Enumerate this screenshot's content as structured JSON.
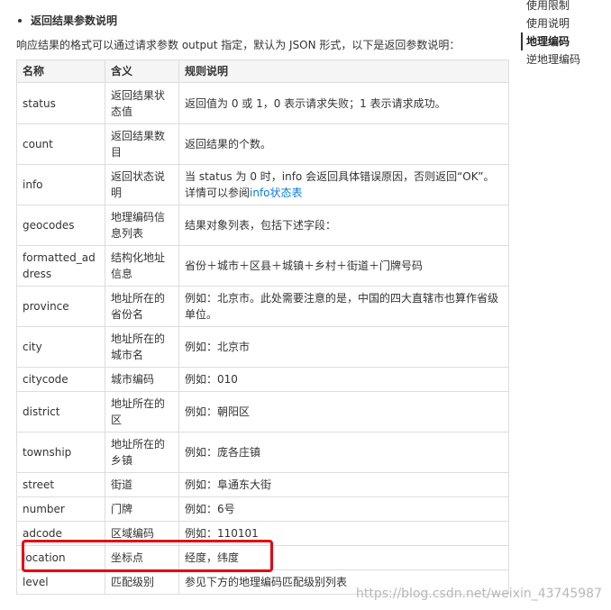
{
  "section": {
    "heading": "返回结果参数说明",
    "description": "响应结果的格式可以通过请求参数 output 指定，默认为 JSON 形式，以下是返回参数说明："
  },
  "table": {
    "headers": [
      "名称",
      "含义",
      "规则说明"
    ],
    "rows": [
      {
        "name": "status",
        "meaning": "返回结果状态值",
        "rule": "返回值为 0 或 1，0 表示请求失败；1 表示请求成功。"
      },
      {
        "name": "count",
        "meaning": "返回结果数目",
        "rule": "返回结果的个数。"
      },
      {
        "name": "info",
        "meaning": "返回状态说明",
        "rule_prefix": "当 status 为 0 时，info 会返回具体错误原因，否则返回“OK”。详情可以参阅",
        "rule_link": "info状态表"
      },
      {
        "name": "geocodes",
        "meaning": "地理编码信息列表",
        "rule": "结果对象列表，包括下述字段："
      },
      {
        "name": "formatted_address",
        "meaning": "结构化地址信息",
        "rule": "省份＋城市＋区县＋城镇＋乡村＋街道＋门牌号码"
      },
      {
        "name": "province",
        "meaning": "地址所在的省份名",
        "rule": "例如：北京市。此处需要注意的是，中国的四大直辖市也算作省级单位。"
      },
      {
        "name": "city",
        "meaning": "地址所在的城市名",
        "rule": "例如：北京市"
      },
      {
        "name": "citycode",
        "meaning": "城市编码",
        "rule": "例如：010"
      },
      {
        "name": "district",
        "meaning": "地址所在的区",
        "rule": "例如：朝阳区"
      },
      {
        "name": "township",
        "meaning": "地址所在的乡镇",
        "rule": "例如：庞各庄镇"
      },
      {
        "name": "street",
        "meaning": "街道",
        "rule": "例如：阜通东大街"
      },
      {
        "name": "number",
        "meaning": "门牌",
        "rule": "例如：6号"
      },
      {
        "name": "adcode",
        "meaning": "区域编码",
        "rule": "例如：110101"
      },
      {
        "name": "location",
        "meaning": "坐标点",
        "rule": "经度，纬度"
      },
      {
        "name": "level",
        "meaning": "匹配级别",
        "rule": "参见下方的地理编码匹配级别列表"
      }
    ]
  },
  "nav": {
    "items": [
      "使用限制",
      "使用说明",
      "地理编码",
      "逆地理编码"
    ],
    "active": "地理编码"
  },
  "watermark": "https://blog.csdn.net/weixin_43745987",
  "colors": {
    "link": "#0a7bd8",
    "highlight": "#e60012",
    "header_bg": "#f5f5f5",
    "border": "#dddddd"
  }
}
